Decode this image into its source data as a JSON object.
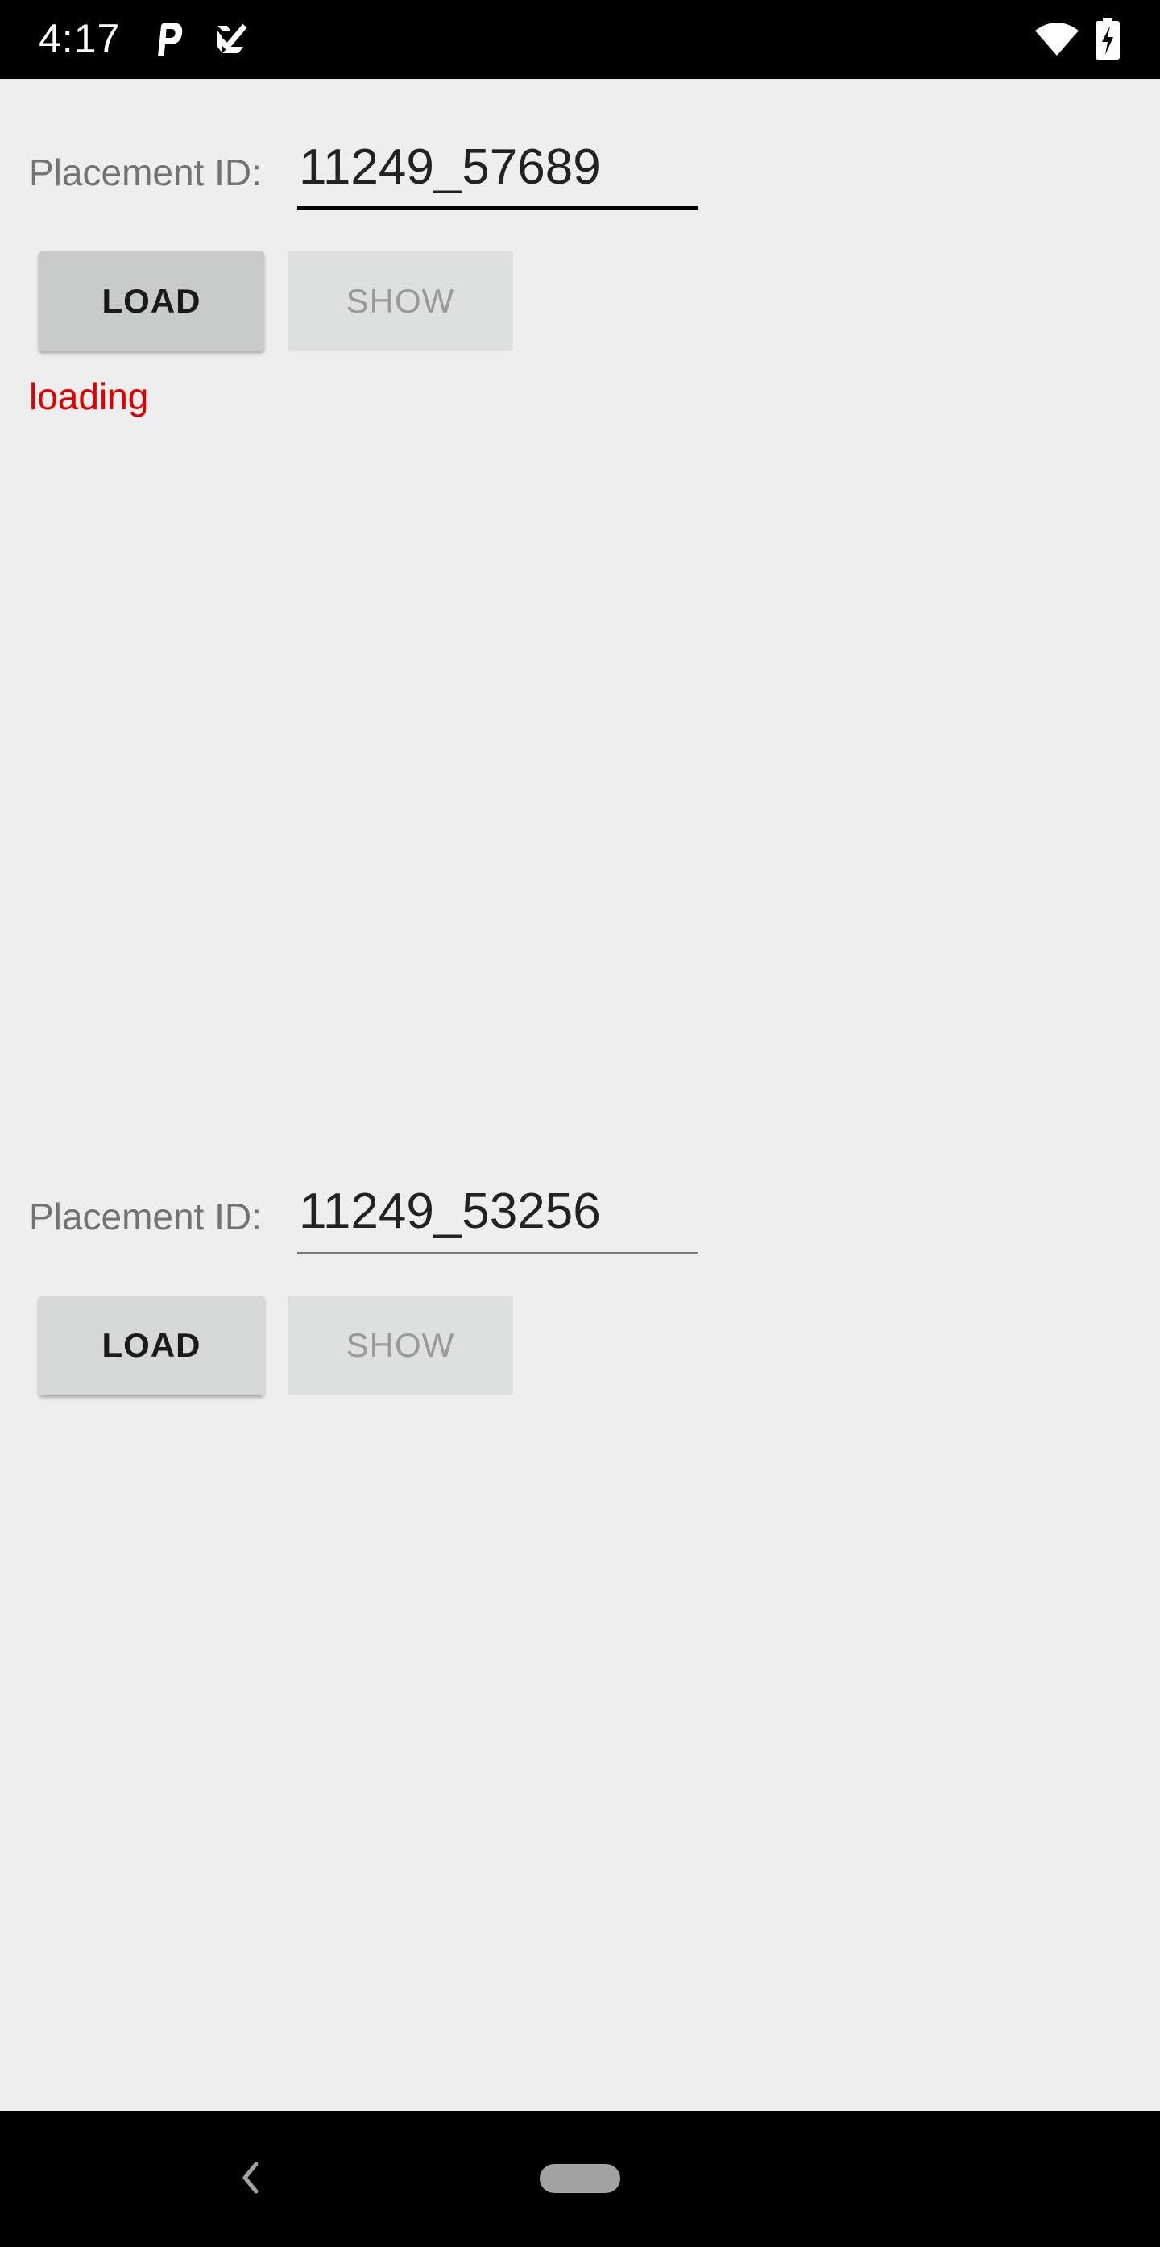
{
  "status_bar": {
    "time": "4:17",
    "icons": [
      "parking-app-icon",
      "tasks-app-icon",
      "wifi-icon",
      "battery-charging-icon"
    ]
  },
  "sections": [
    {
      "label": "Placement ID:",
      "placement_id": "11249_57689",
      "load_label": "LOAD",
      "show_label": "SHOW",
      "status": "loading"
    },
    {
      "label": "Placement ID:",
      "placement_id": "11249_53256",
      "load_label": "LOAD",
      "show_label": "SHOW"
    }
  ],
  "colors": {
    "background": "#eeeeee",
    "status_text": "#e00000",
    "focused_underline": "#000000"
  },
  "nav_bar": {
    "icons": [
      "back-icon",
      "home-pill-icon"
    ]
  }
}
